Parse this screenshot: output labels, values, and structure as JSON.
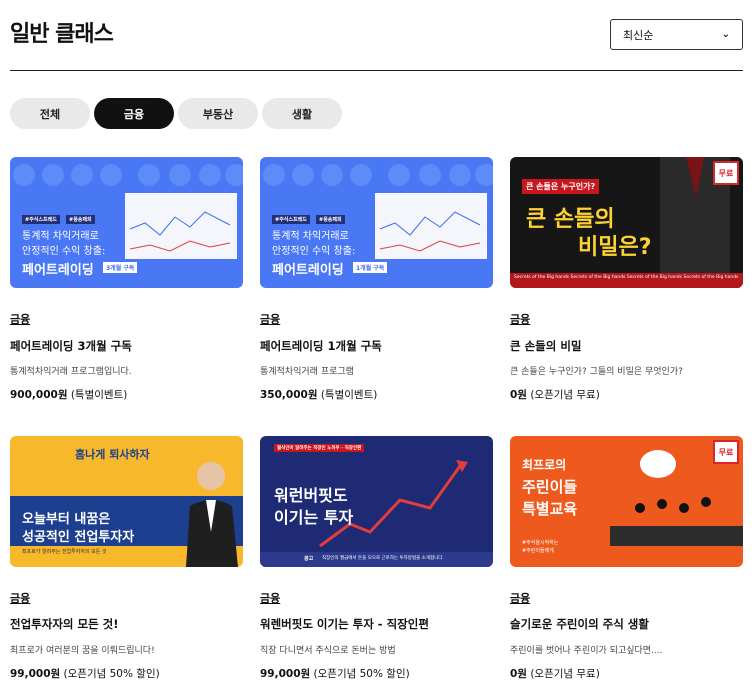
{
  "header": {
    "title": "일반 클래스"
  },
  "sort": {
    "selected": "최신순"
  },
  "tabs": [
    {
      "label": "전체",
      "active": false
    },
    {
      "label": "금융",
      "active": true
    },
    {
      "label": "부동산",
      "active": false
    },
    {
      "label": "생활",
      "active": false
    }
  ],
  "cards": [
    {
      "category": "금융",
      "title": "페어트레이딩 3개월 구독",
      "description": "통계적차익거래 프로그램입니다.",
      "price": "900,000원",
      "price_note": "(특별이벤트)",
      "thumb": {
        "tags": [
          "#주식스프레드",
          "#몽송패희"
        ],
        "line1": "통계적 차익거래로",
        "line2": "안정적인 수익 창출:",
        "headline": "페어트레이딩",
        "badge": "3개월 구독"
      }
    },
    {
      "category": "금융",
      "title": "페어트레이딩 1개월 구독",
      "description": "통계적차익거래 프로그램",
      "price": "350,000원",
      "price_note": "(특별이벤트)",
      "thumb": {
        "tags": [
          "#주식스프레드",
          "#몽송패희"
        ],
        "line1": "통계적 차익거래로",
        "line2": "안정적인 수익 창출:",
        "headline": "페어트레이딩",
        "badge": "1개월 구독"
      }
    },
    {
      "category": "금융",
      "title": "큰 손들의 비밀",
      "description": "큰 손들은 누구인가? 그들의 비밀은 무엇인가?",
      "price": "0원",
      "price_note": "(오픈기념 무료)",
      "thumb": {
        "question": "큰 손들은 누구인가?",
        "headline1": "큰 손들의",
        "headline2": "비밀은?",
        "badge": "무료",
        "footer": "Secrets of the Big hands Secrets of the Big hands Secrets of the Big hands Secrets of the Big hands"
      }
    },
    {
      "category": "금융",
      "title": "전업투자자의 모든 것!",
      "description": "최프로가 여러분의 꿈을 이뤄드립니다!",
      "price": "99,000원",
      "price_note": "(오픈기념 50% 할인)",
      "thumb": {
        "top": "홈나게 퇴사하자",
        "headline1": "오늘부터 내꿈은",
        "headline2": "성공적인 전업투자자",
        "footer": "최프로가 알려주는 전업투자자의 모든 것"
      }
    },
    {
      "category": "금융",
      "title": "워렌버핏도 이기는 투자 - 직장인편",
      "description": "직장 다니면서 주식으로 돈버는 방법",
      "price": "99,000원",
      "price_note": "(오픈기념 50% 할인)",
      "thumb": {
        "pill": "월식인이 알려주는 직장인 노하우 - 직장인편",
        "headline1": "워런버핏도",
        "headline2": "이기는 투자",
        "footer_tag": "광고",
        "footer": "직장인의 월급에서 돈을 모으로 근로하는 투자방법을 소개합니다."
      }
    },
    {
      "category": "금융",
      "title": "슬기로운 주린이의 주식 생활",
      "description": "주린이를 벗어나 주린이가 되고싶다면....",
      "price": "0원",
      "price_note": "(오픈기념 무료)",
      "thumb": {
        "headline1": "최프로의",
        "headline2": "주린이들",
        "headline3": "특별교육",
        "tags": [
          "#주식을시작하는",
          "#주린이들에게"
        ],
        "badge": "무료"
      }
    }
  ],
  "colors": {
    "accent": "#111111",
    "tab_bg": "#e9e9e9",
    "card1_bg": "#3d6ef5",
    "card3_bg": "#151515",
    "card4_bg": "#f7b92b",
    "card5_bg": "#1e2a73",
    "card6_bg": "#ee5a1e"
  }
}
